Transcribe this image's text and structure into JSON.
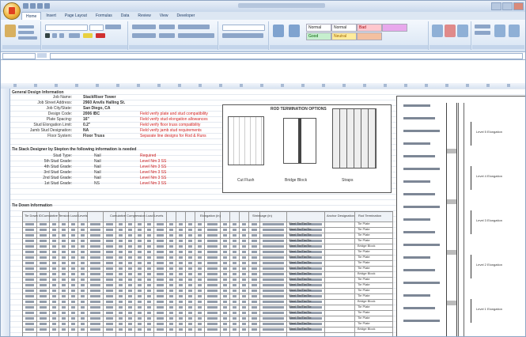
{
  "window": {
    "title": ""
  },
  "ribbon": {
    "tabs": [
      "Home",
      "Insert",
      "Page Layout",
      "Formulas",
      "Data",
      "Review",
      "View",
      "Developer"
    ],
    "active_tab": "Home",
    "style_cells": [
      {
        "label": "Normal",
        "color": "#ffffff"
      },
      {
        "label": "Normal",
        "color": "#ffffff"
      },
      {
        "label": "Bad",
        "color": "#ffc7ce"
      },
      {
        "label": "Good",
        "color": "#c6efce"
      },
      {
        "label": "Neutral",
        "color": "#ffeb9c"
      }
    ]
  },
  "formula_bar": {
    "fx_label": "fx"
  },
  "sheet": {
    "general_title": "General Design Information",
    "general_rows": [
      {
        "label": "Job Name:",
        "value": "StackRiser Tower"
      },
      {
        "label": "Job Street Address:",
        "value": "2960 Anvils Halling St."
      },
      {
        "label": "Job City/State:",
        "value": "San Diego, CA"
      },
      {
        "label": "Design Code:",
        "value": "2006 IBC"
      },
      {
        "label": "Plate Spacing:",
        "value": "16\""
      },
      {
        "label": "Stud Elongation Limit:",
        "value": "0.2\""
      },
      {
        "label": "Jamb Stud Designation:",
        "value": "NA"
      },
      {
        "label": "Floor System:",
        "value": "Floor Truss"
      }
    ],
    "general_notes": [
      "Field verify plate and stud compatibility",
      "Field verify stud elongation allowances",
      "Field verify floor truss compatibility",
      "Field verify jamb stud requirements",
      "Separate line designs for Rod & Runs"
    ],
    "stud_title": "Tie Stack Designer by Stepton the following information is needed",
    "stud_rows": [
      {
        "label": "Stud Type:",
        "value": "Nail"
      },
      {
        "label": "5th Stud Grade:",
        "value": "Nail"
      },
      {
        "label": "4th Stud Grade:",
        "value": "Nail"
      },
      {
        "label": "3rd Stud Grade:",
        "value": "Nail"
      },
      {
        "label": "2nd Stud Grade:",
        "value": "Nail"
      },
      {
        "label": "1st Stud Grade:",
        "value": "NS"
      }
    ],
    "stud_notes": [
      "Required",
      "Level Nm 3 SS",
      "Level Nm 3 SS",
      "Level Nm 3 SS",
      "Level Nm 3 SS",
      "Level Nm 3 SS"
    ],
    "termination_title": "ROD TERMINATION OPTIONS",
    "termination_options": [
      "Cut Flush",
      "Bridge Block",
      "Straps"
    ],
    "tie_title": "Tie Down Information",
    "table_headers": [
      "Tie Down ID",
      "Cumulative Tension Load Levels",
      "Cumulative Compression Load Levels",
      "Elongation (in)",
      "Shrinkage (in)",
      "Anchor Designation",
      "Rod Termination"
    ],
    "anchor_values": [
      "Steel Tie/Tie/Tie",
      "Steel Tie/Tie/Tie",
      "Steel Tie/Tie/Tie"
    ],
    "termination_values": [
      "Tie Plate",
      "Tie Plate",
      "Bridge Block"
    ],
    "rows": 20
  },
  "riser_panel": {
    "labels": [
      "Level 5 Elongation",
      "Level 4 Elongation",
      "Level 3 Elongation",
      "Level 2 Elongation",
      "Level 1 Elongation"
    ]
  }
}
